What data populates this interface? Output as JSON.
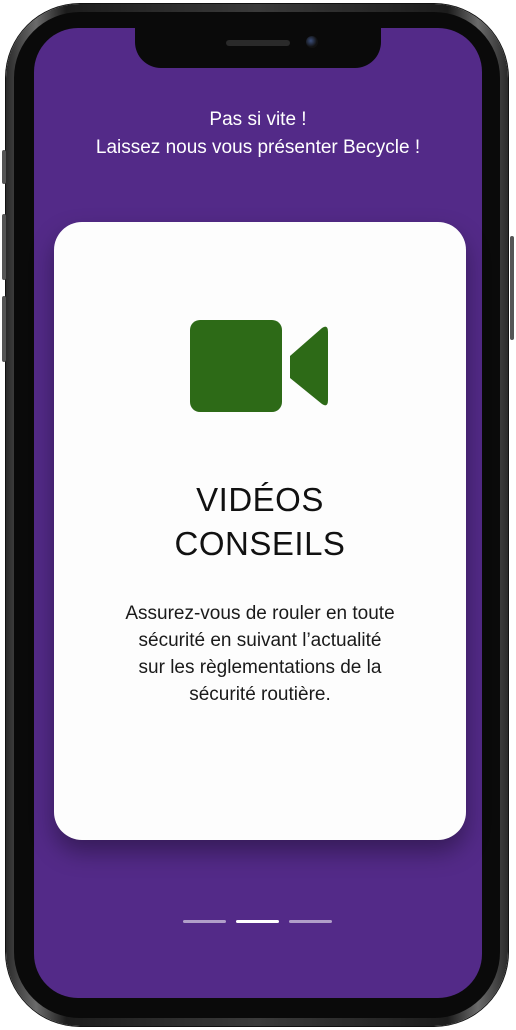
{
  "intro": {
    "line1": "Pas si vite !",
    "line2": "Laissez nous vous présenter Becycle !"
  },
  "card": {
    "icon": "video-camera-icon",
    "icon_color": "#2d6a17",
    "title_line1": "VIDÉOS",
    "title_line2": "CONSEILS",
    "description": [
      "Assurez-vous de rouler en toute",
      "sécurité en suivant l’actualité",
      "sur les règlementations de la",
      "sécurité routière."
    ]
  },
  "pager": {
    "page_count": 3,
    "active_index": 1
  },
  "colors": {
    "background": "#532a88",
    "card": "#fdfdfd",
    "accent": "#2d6a17"
  }
}
